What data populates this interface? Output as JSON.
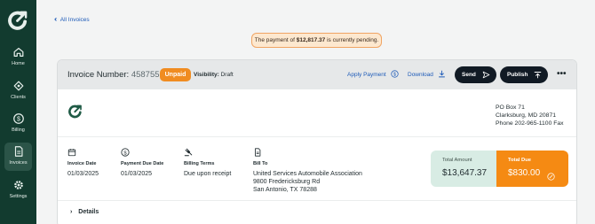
{
  "sidebar": {
    "items": [
      {
        "label": "Home",
        "icon": "home-icon"
      },
      {
        "label": "Clients",
        "icon": "clients-icon"
      },
      {
        "label": "Billing",
        "icon": "billing-icon"
      },
      {
        "label": "Invoices",
        "icon": "invoices-icon",
        "active": true
      },
      {
        "label": "Settings",
        "icon": "settings-icon"
      }
    ]
  },
  "breadcrumb": {
    "back_label": "All Invoices"
  },
  "notice": {
    "prefix": "The payment of ",
    "amount": "$12,817.37",
    "suffix": " is currently pending."
  },
  "invoice": {
    "number_label": "Invoice Number:",
    "number": "4587551",
    "status": "Unpaid",
    "visibility_label": "Visibility:",
    "visibility_value": "Draft"
  },
  "actions": {
    "apply_payment": "Apply Payment",
    "download": "Download",
    "send": "Send",
    "publish": "Publish",
    "more": "•••"
  },
  "company": {
    "address_line1": "PO Box 71",
    "address_line2": "Clarksburg, MD 20871",
    "phone": "Phone 202-965-1100 Fax"
  },
  "meta": {
    "invoice_date_label": "Invoice Date",
    "invoice_date": "01/03/2025",
    "due_date_label": "Payment Due Date",
    "due_date": "01/03/2025",
    "billing_terms_label": "Billing Terms",
    "billing_terms": "Due upon receipt",
    "bill_to_label": "Bill To",
    "bill_to_name": "United Services Automobile Association",
    "bill_to_street": "9800 Fredericksburg Rd",
    "bill_to_city": "San Antonio, TX 78288"
  },
  "totals": {
    "amount_label": "Total Amount",
    "amount": "$13,647.37",
    "due_label": "Total Due",
    "due": "$830.00"
  },
  "details": {
    "label": "Details"
  },
  "colors": {
    "sidebar": "#123b2f",
    "accent_orange": "#f58a13",
    "link": "#1e5bb8",
    "total_amount_bg": "#d8ece4"
  }
}
